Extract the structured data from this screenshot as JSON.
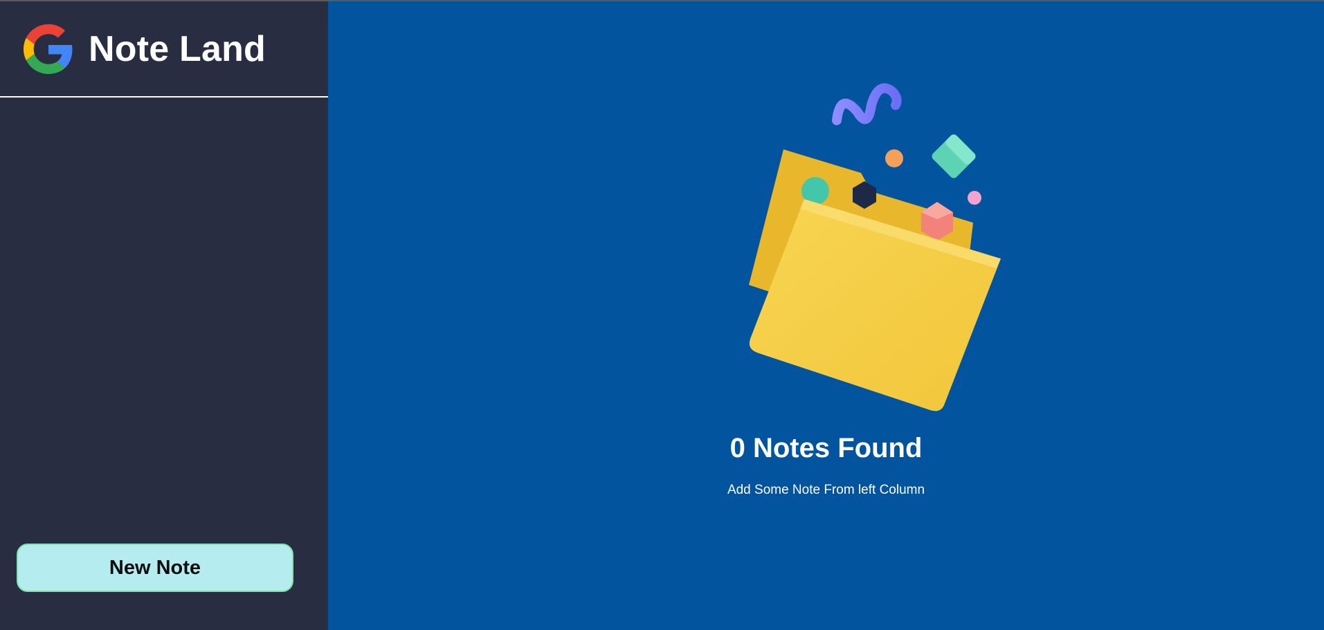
{
  "sidebar": {
    "app_title": "Note Land",
    "logo_icon": "google-g-icon",
    "new_note_label": "New Note"
  },
  "main": {
    "illustration_icon": "empty-folder-illustration",
    "empty_title": "0 Notes Found",
    "empty_subtitle": "Add Some Note From left Column"
  },
  "colors": {
    "sidebar_bg": "#282d42",
    "main_bg": "#02549e",
    "button_bg": "#b5ecf0",
    "button_border": "#7fe3b0",
    "folder": "#f6cf47"
  }
}
